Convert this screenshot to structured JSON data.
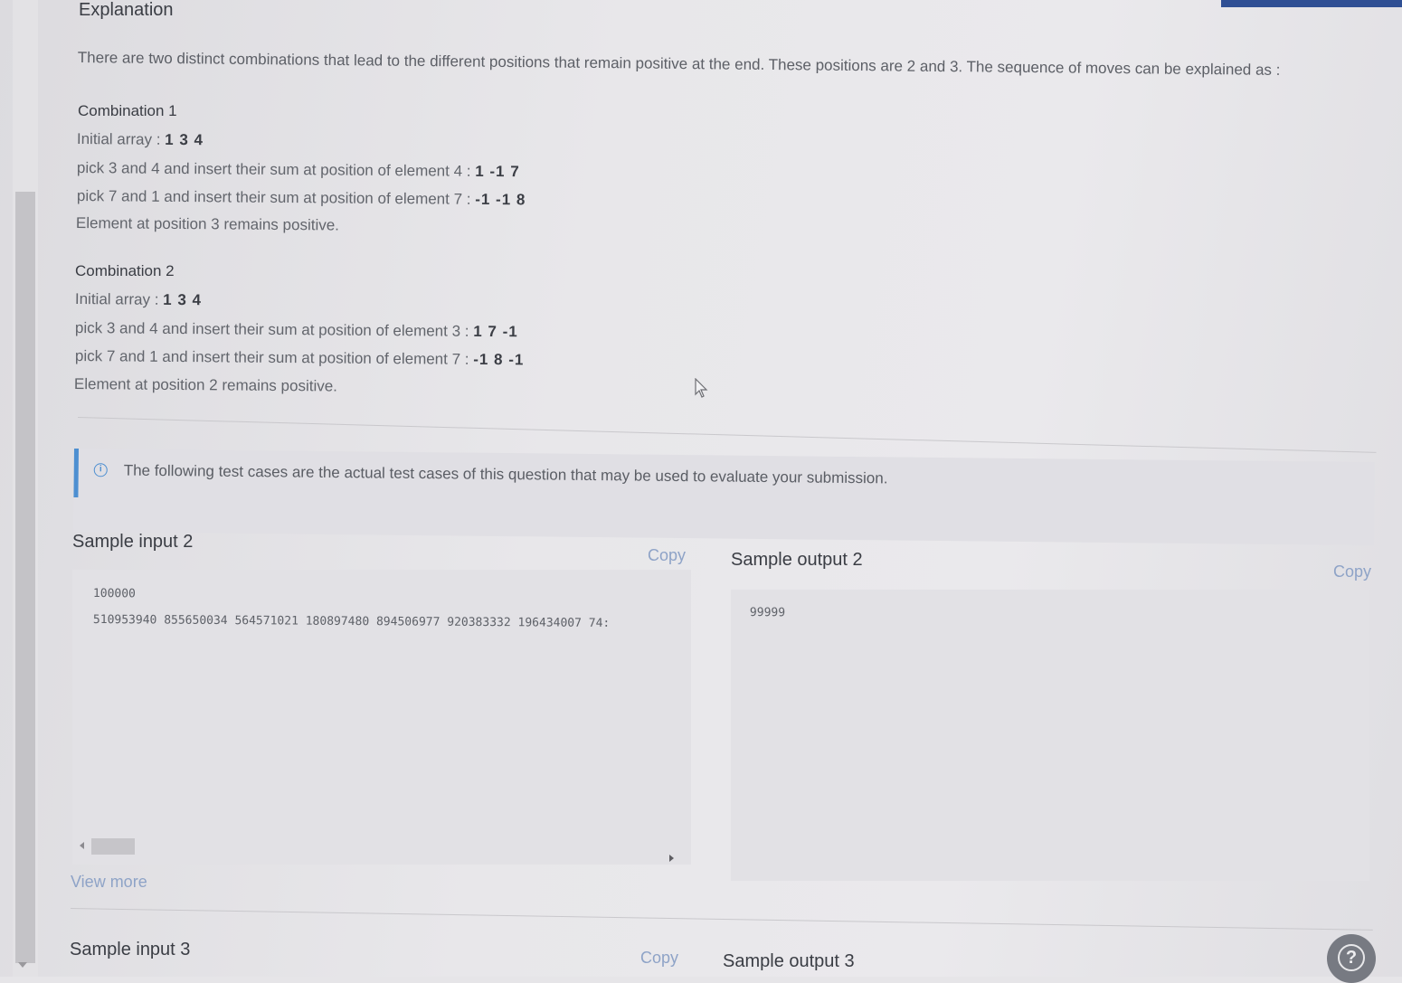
{
  "explanation": {
    "heading": "Explanation",
    "intro": "There are two distinct combinations that lead to the different positions that remain positive at the end. These positions are 2 and 3. The sequence of moves can be explained as :",
    "combinations": [
      {
        "title": "Combination 1",
        "initial_label": "Initial array : ",
        "initial_value": "1 3 4",
        "step1_text": "pick 3 and 4 and insert their sum at position of element 4 : ",
        "step1_value": "1 -1 7",
        "step2_text": "pick 7 and 1 and insert their sum at position of element 7 : ",
        "step2_value": "-1 -1 8",
        "result": "Element at position 3 remains positive."
      },
      {
        "title": "Combination 2",
        "initial_label": "Initial array : ",
        "initial_value": "1 3 4",
        "step1_text": "pick 3 and 4 and insert their sum at position of element 3 : ",
        "step1_value": "1 7 -1",
        "step2_text": "pick 7 and 1 and insert their sum at position of element 7 : ",
        "step2_value": "-1 8 -1",
        "result": "Element at position 2 remains positive."
      }
    ]
  },
  "notice": {
    "icon": "info-icon",
    "text": "The following test cases are the actual test cases of this question that may be used to evaluate your submission."
  },
  "samples": {
    "input2": {
      "title": "Sample input 2",
      "copy_label": "Copy",
      "lines": [
        "100000",
        "510953940 855650034 564571021 180897480 894506977 920383332 196434007 74:"
      ],
      "view_more_label": "View more"
    },
    "output2": {
      "title": "Sample output 2",
      "copy_label": "Copy",
      "lines": [
        "99999"
      ]
    },
    "input3": {
      "title": "Sample input 3",
      "copy_label": "Copy"
    },
    "output3": {
      "title": "Sample output 3"
    }
  },
  "help": {
    "icon": "help-icon",
    "label": "?"
  },
  "colors": {
    "link": "#8ea3c7",
    "info_accent": "#4d8fd1",
    "top_accent": "#2f4f94"
  }
}
